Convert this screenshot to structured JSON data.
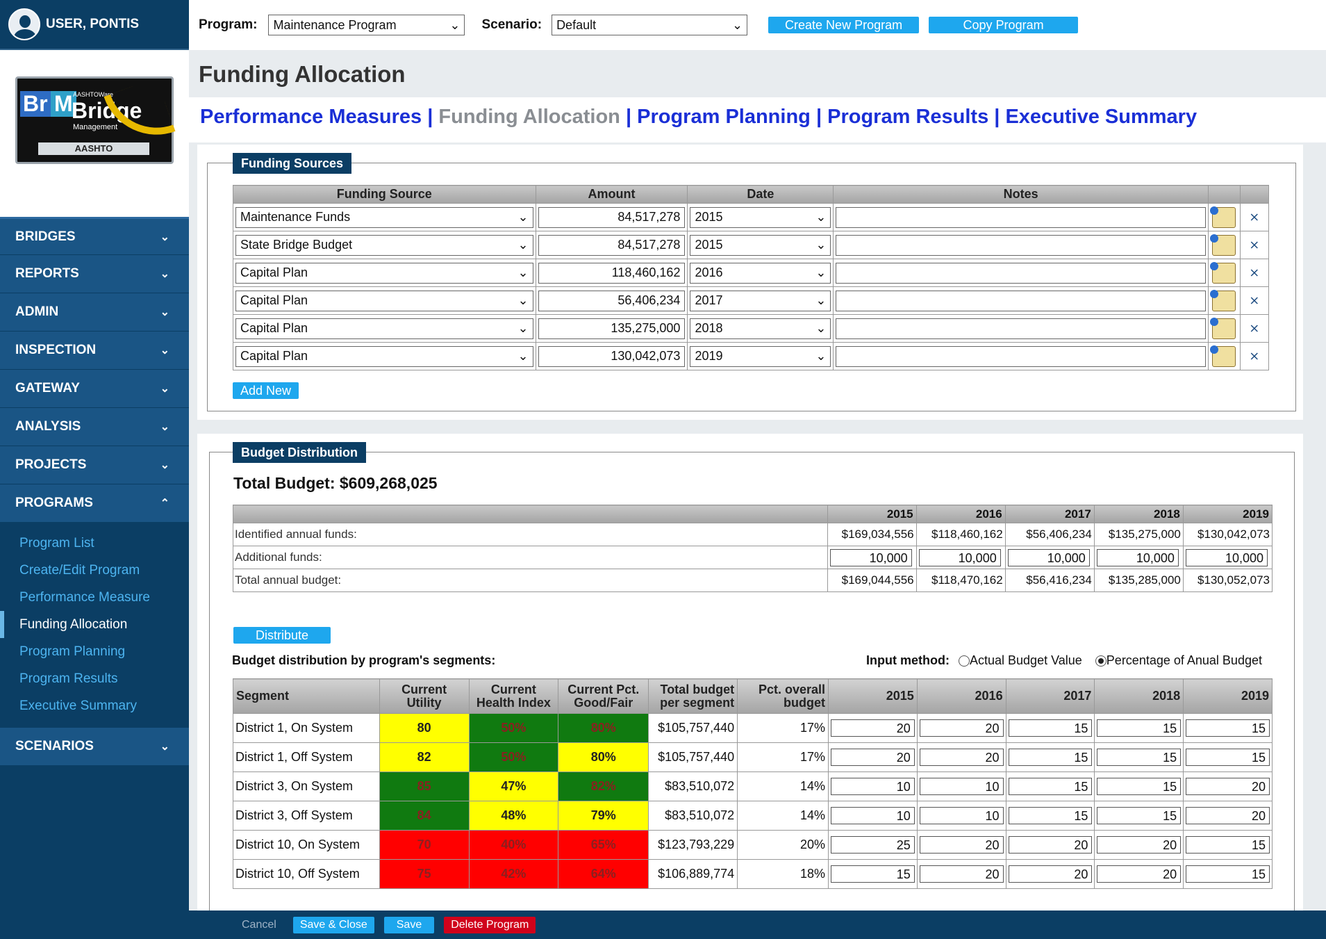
{
  "user": {
    "name": "USER, PONTIS"
  },
  "logo": {
    "brm": "Br",
    "m": "M",
    "aashtoware": "AASHTOWare",
    "bridge": "Bridge",
    "management": "Management",
    "aashto": "AASHTO"
  },
  "nav": [
    {
      "label": "BRIDGES",
      "expanded": false
    },
    {
      "label": "REPORTS",
      "expanded": false
    },
    {
      "label": "ADMIN",
      "expanded": false
    },
    {
      "label": "INSPECTION",
      "expanded": false
    },
    {
      "label": "GATEWAY",
      "expanded": false
    },
    {
      "label": "ANALYSIS",
      "expanded": false
    },
    {
      "label": "PROJECTS",
      "expanded": false
    },
    {
      "label": "PROGRAMS",
      "expanded": true
    },
    {
      "label": "SCENARIOS",
      "expanded": false
    }
  ],
  "programs_sub": [
    "Program List",
    "Create/Edit Program",
    "Performance Measure",
    "Funding Allocation",
    "Program Planning",
    "Program Results",
    "Executive Summary"
  ],
  "topbar": {
    "program_label": "Program:",
    "program_value": "Maintenance Program",
    "scenario_label": "Scenario:",
    "scenario_value": "Default",
    "create_btn": "Create New Program",
    "copy_btn": "Copy Program"
  },
  "page_title": "Funding Allocation",
  "subnav": {
    "performance": "Performance Measures",
    "sep1": " | ",
    "funding": "Funding Allocation",
    "sep2": " | ",
    "planning": "Program Planning",
    "sep3": "  | ",
    "results": "Program Results",
    "sep4": " | ",
    "executive": "Executive Summary"
  },
  "funding_sources": {
    "legend": "Funding Sources",
    "headers": [
      "Funding Source",
      "Amount",
      "Date",
      "Notes"
    ],
    "rows": [
      {
        "source": "Maintenance Funds",
        "amount": "84,517,278",
        "date": "2015",
        "notes": ""
      },
      {
        "source": "State Bridge Budget",
        "amount": "84,517,278",
        "date": "2015",
        "notes": ""
      },
      {
        "source": "Capital Plan",
        "amount": "118,460,162",
        "date": "2016",
        "notes": ""
      },
      {
        "source": "Capital Plan",
        "amount": "56,406,234",
        "date": "2017",
        "notes": ""
      },
      {
        "source": "Capital Plan",
        "amount": "135,275,000",
        "date": "2018",
        "notes": ""
      },
      {
        "source": "Capital Plan",
        "amount": "130,042,073",
        "date": "2019",
        "notes": ""
      }
    ],
    "add_new": "Add New"
  },
  "budget": {
    "legend": "Budget Distribution",
    "total_label": "Total Budget: $609,268,025",
    "years": [
      "2015",
      "2016",
      "2017",
      "2018",
      "2019"
    ],
    "identified_label": "Identified annual funds:",
    "identified": [
      "$169,034,556",
      "$118,460,162",
      "$56,406,234",
      "$135,275,000",
      "$130,042,073"
    ],
    "additional_label": "Additional funds:",
    "additional": [
      "10,000",
      "10,000",
      "10,000",
      "10,000",
      "10,000"
    ],
    "total_annual_label": "Total annual budget:",
    "total_annual": [
      "$169,044,556",
      "$118,470,162",
      "$56,416,234",
      "$135,285,000",
      "$130,052,073"
    ],
    "distribute_btn": "Distribute",
    "dist_label": "Budget distribution by program's segments:",
    "input_method_label": "Input method:",
    "input_actual": "Actual Budget Value",
    "input_pct": "Percentage of Anual Budget",
    "input_selected": "pct",
    "seg_headers": [
      "Segment",
      "Current Utility",
      "Current Health Index",
      "Current Pct. Good/Fair",
      "Total budget per segment",
      "Pct. overall budget",
      "2015",
      "2016",
      "2017",
      "2018",
      "2019"
    ],
    "segments": [
      {
        "name": "District 1, On System",
        "utility": "80",
        "utility_color": "yellow",
        "health": "50%",
        "health_color": "green",
        "good": "80%",
        "good_color": "green",
        "total": "$105,757,440",
        "pct": "17%",
        "years": [
          "20",
          "20",
          "15",
          "15",
          "15"
        ]
      },
      {
        "name": "District 1, Off System",
        "utility": "82",
        "utility_color": "yellow",
        "health": "50%",
        "health_color": "green",
        "good": "80%",
        "good_color": "yellow",
        "total": "$105,757,440",
        "pct": "17%",
        "years": [
          "20",
          "20",
          "15",
          "15",
          "15"
        ]
      },
      {
        "name": "District 3, On System",
        "utility": "85",
        "utility_color": "green",
        "health": "47%",
        "health_color": "yellow",
        "good": "82%",
        "good_color": "green",
        "total": "$83,510,072",
        "pct": "14%",
        "years": [
          "10",
          "10",
          "15",
          "15",
          "20"
        ]
      },
      {
        "name": "District 3, Off System",
        "utility": "84",
        "utility_color": "green",
        "health": "48%",
        "health_color": "yellow",
        "good": "79%",
        "good_color": "yellow",
        "total": "$83,510,072",
        "pct": "14%",
        "years": [
          "10",
          "10",
          "15",
          "15",
          "20"
        ]
      },
      {
        "name": "District 10, On System",
        "utility": "70",
        "utility_color": "red",
        "health": "40%",
        "health_color": "red",
        "good": "65%",
        "good_color": "red",
        "total": "$123,793,229",
        "pct": "20%",
        "years": [
          "25",
          "20",
          "20",
          "20",
          "15"
        ]
      },
      {
        "name": "District 10, Off System",
        "utility": "75",
        "utility_color": "red",
        "health": "42%",
        "health_color": "red",
        "good": "64%",
        "good_color": "red",
        "total": "$106,889,774",
        "pct": "18%",
        "years": [
          "15",
          "20",
          "20",
          "20",
          "15"
        ]
      }
    ]
  },
  "footer": {
    "cancel": "Cancel",
    "save_close": "Save & Close",
    "save": "Save",
    "delete": "Delete Program"
  },
  "colors": {
    "sidebar": "#0b3e64",
    "nav_item": "#1a5585",
    "link_blue": "#1a2fd6",
    "button_blue": "#1ea7ee",
    "delete_red": "#d0021b",
    "yellow": "#ffff00",
    "green": "#107a10",
    "red": "#ff0000"
  }
}
